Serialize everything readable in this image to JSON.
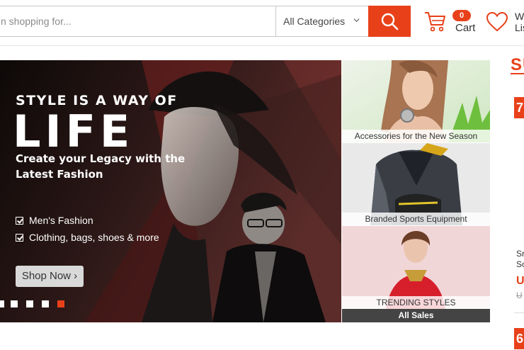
{
  "header": {
    "search_placeholder": "n shopping for...",
    "category": "All Categories",
    "cart_count": "0",
    "cart_label": "Cart",
    "wishlist_label_1": "W",
    "wishlist_label_2": "Lis"
  },
  "hero": {
    "tagline": "STYLE IS A WAY OF",
    "headline": "LIFE",
    "subheadline": "Create your Legacy with the Latest Fashion",
    "features": [
      "Men's Fashion",
      "Clothing, bags, shoes & more"
    ],
    "cta": "Shop Now ›",
    "active_slide": 5,
    "slide_count": 5
  },
  "tiles": [
    {
      "caption": "Accessories for the New Season"
    },
    {
      "caption": "Branded Sports Equipment"
    },
    {
      "caption": "TRENDING STYLES",
      "footer": "All Sales"
    }
  ],
  "sidebar": {
    "title": "SU",
    "badge_1": "7",
    "product_line_1": "Sr",
    "product_line_2": "Sc",
    "price": "U",
    "old_price": "U",
    "badge_2": "6"
  },
  "colors": {
    "accent": "#e8411a",
    "dark_tile_footer": "#444444"
  }
}
